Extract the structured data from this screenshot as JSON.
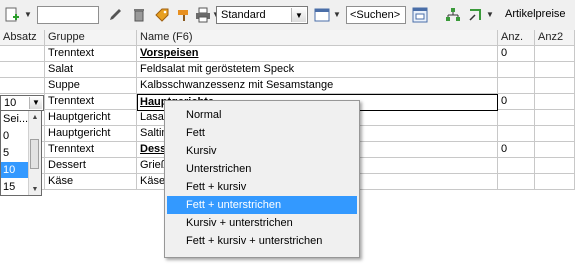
{
  "toolbar": {
    "search_value": "",
    "format_select": "Standard",
    "suchen_label": "<Suchen>",
    "artikelpreise_label": "Artikelpreise",
    "icons": [
      "new-icon",
      "pencil-icon",
      "trash-icon",
      "tag-icon",
      "brush-icon",
      "print-icon",
      "columns-icon",
      "search-window-icon",
      "tree-icon",
      "arrow-icon"
    ]
  },
  "grid": {
    "headers": [
      "Absatz",
      "Gruppe",
      "Name (F6)",
      "Anz.",
      "Anz2"
    ],
    "rows": [
      {
        "absatz": "",
        "gruppe": "Trenntext",
        "name": "Vorspeisen",
        "anz": "0",
        "bold": true
      },
      {
        "absatz": "",
        "gruppe": "Salat",
        "name": "Feldsalat mit geröstetem Speck",
        "anz": "",
        "bold": false
      },
      {
        "absatz": "",
        "gruppe": "Suppe",
        "name": "Kalbsschwanzessenz mit Sesamstange",
        "anz": "",
        "bold": false
      },
      {
        "absatz": "10",
        "gruppe": "Trenntext",
        "name": "Hauptgerichte",
        "anz": "0",
        "bold": true
      },
      {
        "absatz": "",
        "gruppe": "Hauptgericht",
        "name": "Lasag",
        "anz": "",
        "bold": false
      },
      {
        "absatz": "",
        "gruppe": "Hauptgericht",
        "name": "Saltim",
        "anz": "",
        "bold": false
      },
      {
        "absatz": "",
        "gruppe": "Trenntext",
        "name": "Dess",
        "anz": "0",
        "bold": true
      },
      {
        "absatz": "",
        "gruppe": "Dessert",
        "name": "Grieß",
        "anz": "",
        "bold": false
      },
      {
        "absatz": "",
        "gruppe": "Käse",
        "name": "Käsel",
        "anz": "",
        "bold": false
      }
    ]
  },
  "absatz_dropdown": {
    "current": "10",
    "options": [
      "Sei...",
      "0",
      "5",
      "10",
      "15"
    ],
    "selected_index": 3
  },
  "context_menu": {
    "items": [
      "Normal",
      "Fett",
      "Kursiv",
      "Unterstrichen",
      "Fett + kursiv",
      "Fett + unterstrichen",
      "Kursiv + unterstrichen",
      "Fett + kursiv + unterstrichen"
    ],
    "highlighted_index": 5
  },
  "colors": {
    "highlight": "#3399ff",
    "toolbar_bg": "#f0f0f0",
    "grid_line": "#c8c8c8"
  }
}
